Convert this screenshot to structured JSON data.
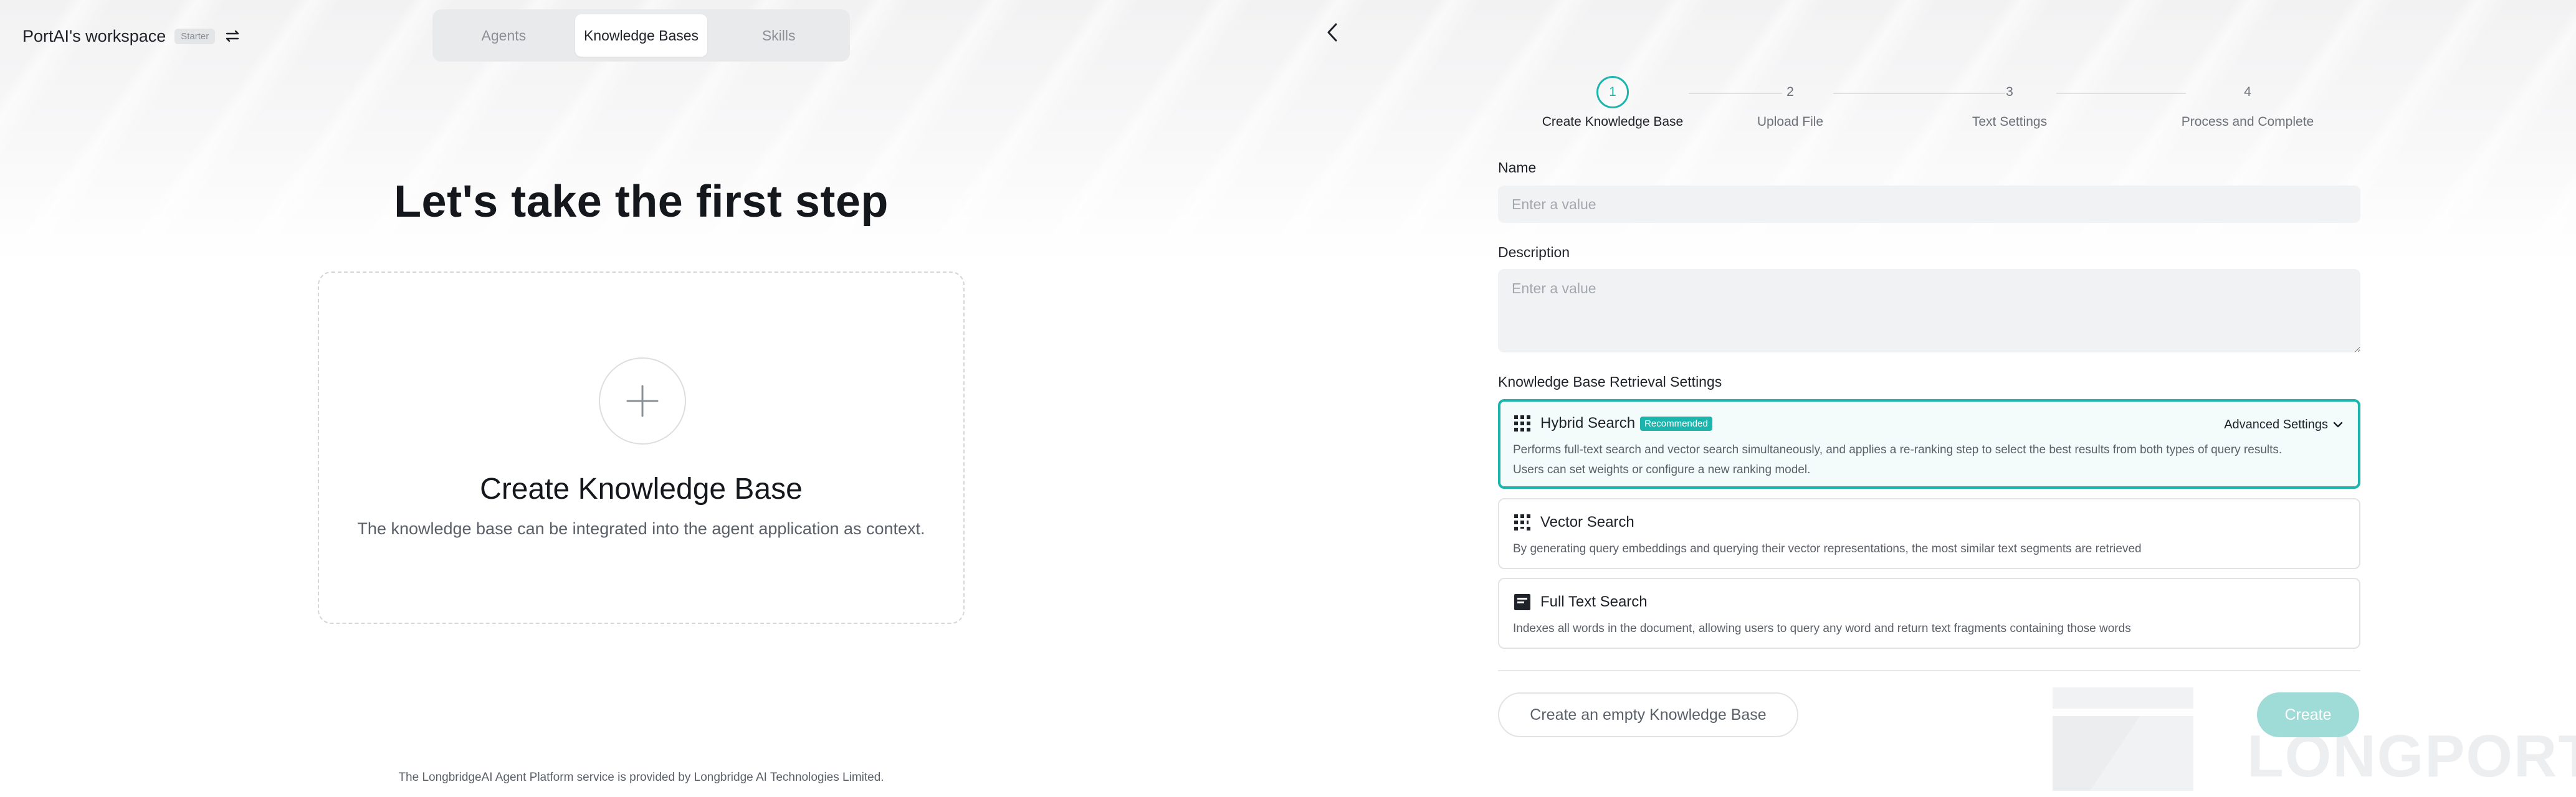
{
  "header": {
    "workspace_name": "PortAI's workspace",
    "plan_badge": "Starter"
  },
  "nav": {
    "tabs": [
      {
        "label": "Agents",
        "active": false
      },
      {
        "label": "Knowledge Bases",
        "active": true
      },
      {
        "label": "Skills",
        "active": false
      }
    ]
  },
  "hero": {
    "title": "Let's take the first step",
    "card_title": "Create Knowledge Base",
    "card_subtitle": "The knowledge base can be integrated into the agent application as context."
  },
  "footer": {
    "note": "The LongbridgeAI Agent Platform service is provided by Longbridge AI Technologies Limited."
  },
  "stepper": {
    "current": 1,
    "steps": [
      {
        "number": "1",
        "label": "Create Knowledge Base"
      },
      {
        "number": "2",
        "label": "Upload File"
      },
      {
        "number": "3",
        "label": "Text Settings"
      },
      {
        "number": "4",
        "label": "Process and Complete"
      }
    ]
  },
  "form": {
    "name_label": "Name",
    "name_placeholder": "Enter a value",
    "name_value": "",
    "description_label": "Description",
    "description_placeholder": "Enter a value",
    "description_value": "",
    "retrieval_label": "Knowledge Base Retrieval Settings",
    "options": [
      {
        "title": "Hybrid Search",
        "badge": "Recommended",
        "selected": true,
        "advanced_label": "Advanced Settings",
        "description_line1": "Performs full-text search and vector search simultaneously, and applies a re-ranking step to select the best results from both types of query results.",
        "description_line2": "Users can set weights or configure a new ranking model.",
        "icon": "grid-dots-icon"
      },
      {
        "title": "Vector Search",
        "selected": false,
        "description_line1": "By generating query embeddings and querying their vector representations, the most similar text segments are retrieved",
        "icon": "vector-grid-icon"
      },
      {
        "title": "Full Text Search",
        "selected": false,
        "description_line1": "Indexes all words in the document, allowing users to query any word and return text fragments containing those words",
        "icon": "document-lines-icon"
      }
    ],
    "empty_kb_button": "Create an empty Knowledge Base",
    "create_button": "Create"
  },
  "watermark": {
    "text": "LONGPORT"
  },
  "colors": {
    "accent": "#1bb5ad",
    "accent_disabled": "#9fdcd8",
    "selected_bg": "#f3fbfb"
  }
}
